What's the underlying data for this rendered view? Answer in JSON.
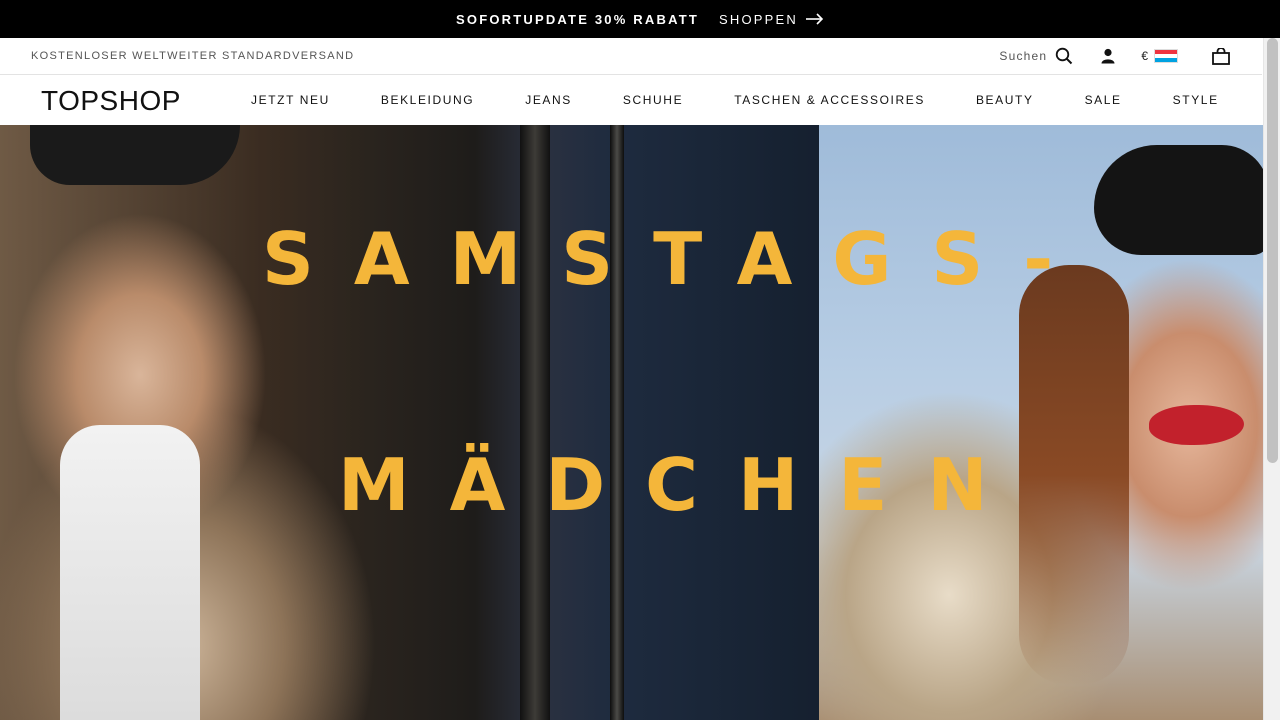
{
  "promo": {
    "text": "SOFORTUPDATE 30% RABATT",
    "link_label": "SHOPPEN"
  },
  "utility": {
    "shipping_text": "KOSTENLOSER WELTWEITER STANDARDVERSAND",
    "search_label": "Suchen",
    "currency_symbol": "€",
    "flag_colors": [
      "#ef3340",
      "#ffffff",
      "#00a2e1"
    ]
  },
  "header": {
    "logo": "TOPSHOP",
    "nav": [
      {
        "label": "JETZT NEU"
      },
      {
        "label": "BEKLEIDUNG"
      },
      {
        "label": "JEANS"
      },
      {
        "label": "SCHUHE"
      },
      {
        "label": "TASCHEN & ACCESSOIRES"
      },
      {
        "label": "BEAUTY"
      },
      {
        "label": "SALE"
      },
      {
        "label": "STYLE"
      }
    ]
  },
  "hero": {
    "headline_line1": "SAMSTAGS-",
    "headline_line2": "MÄDCHEN",
    "headline_color": "#f4b63a"
  },
  "icons": {
    "search": "search-icon",
    "account": "user-icon",
    "bag": "shopping-bag-icon",
    "arrow": "arrow-right-icon"
  }
}
